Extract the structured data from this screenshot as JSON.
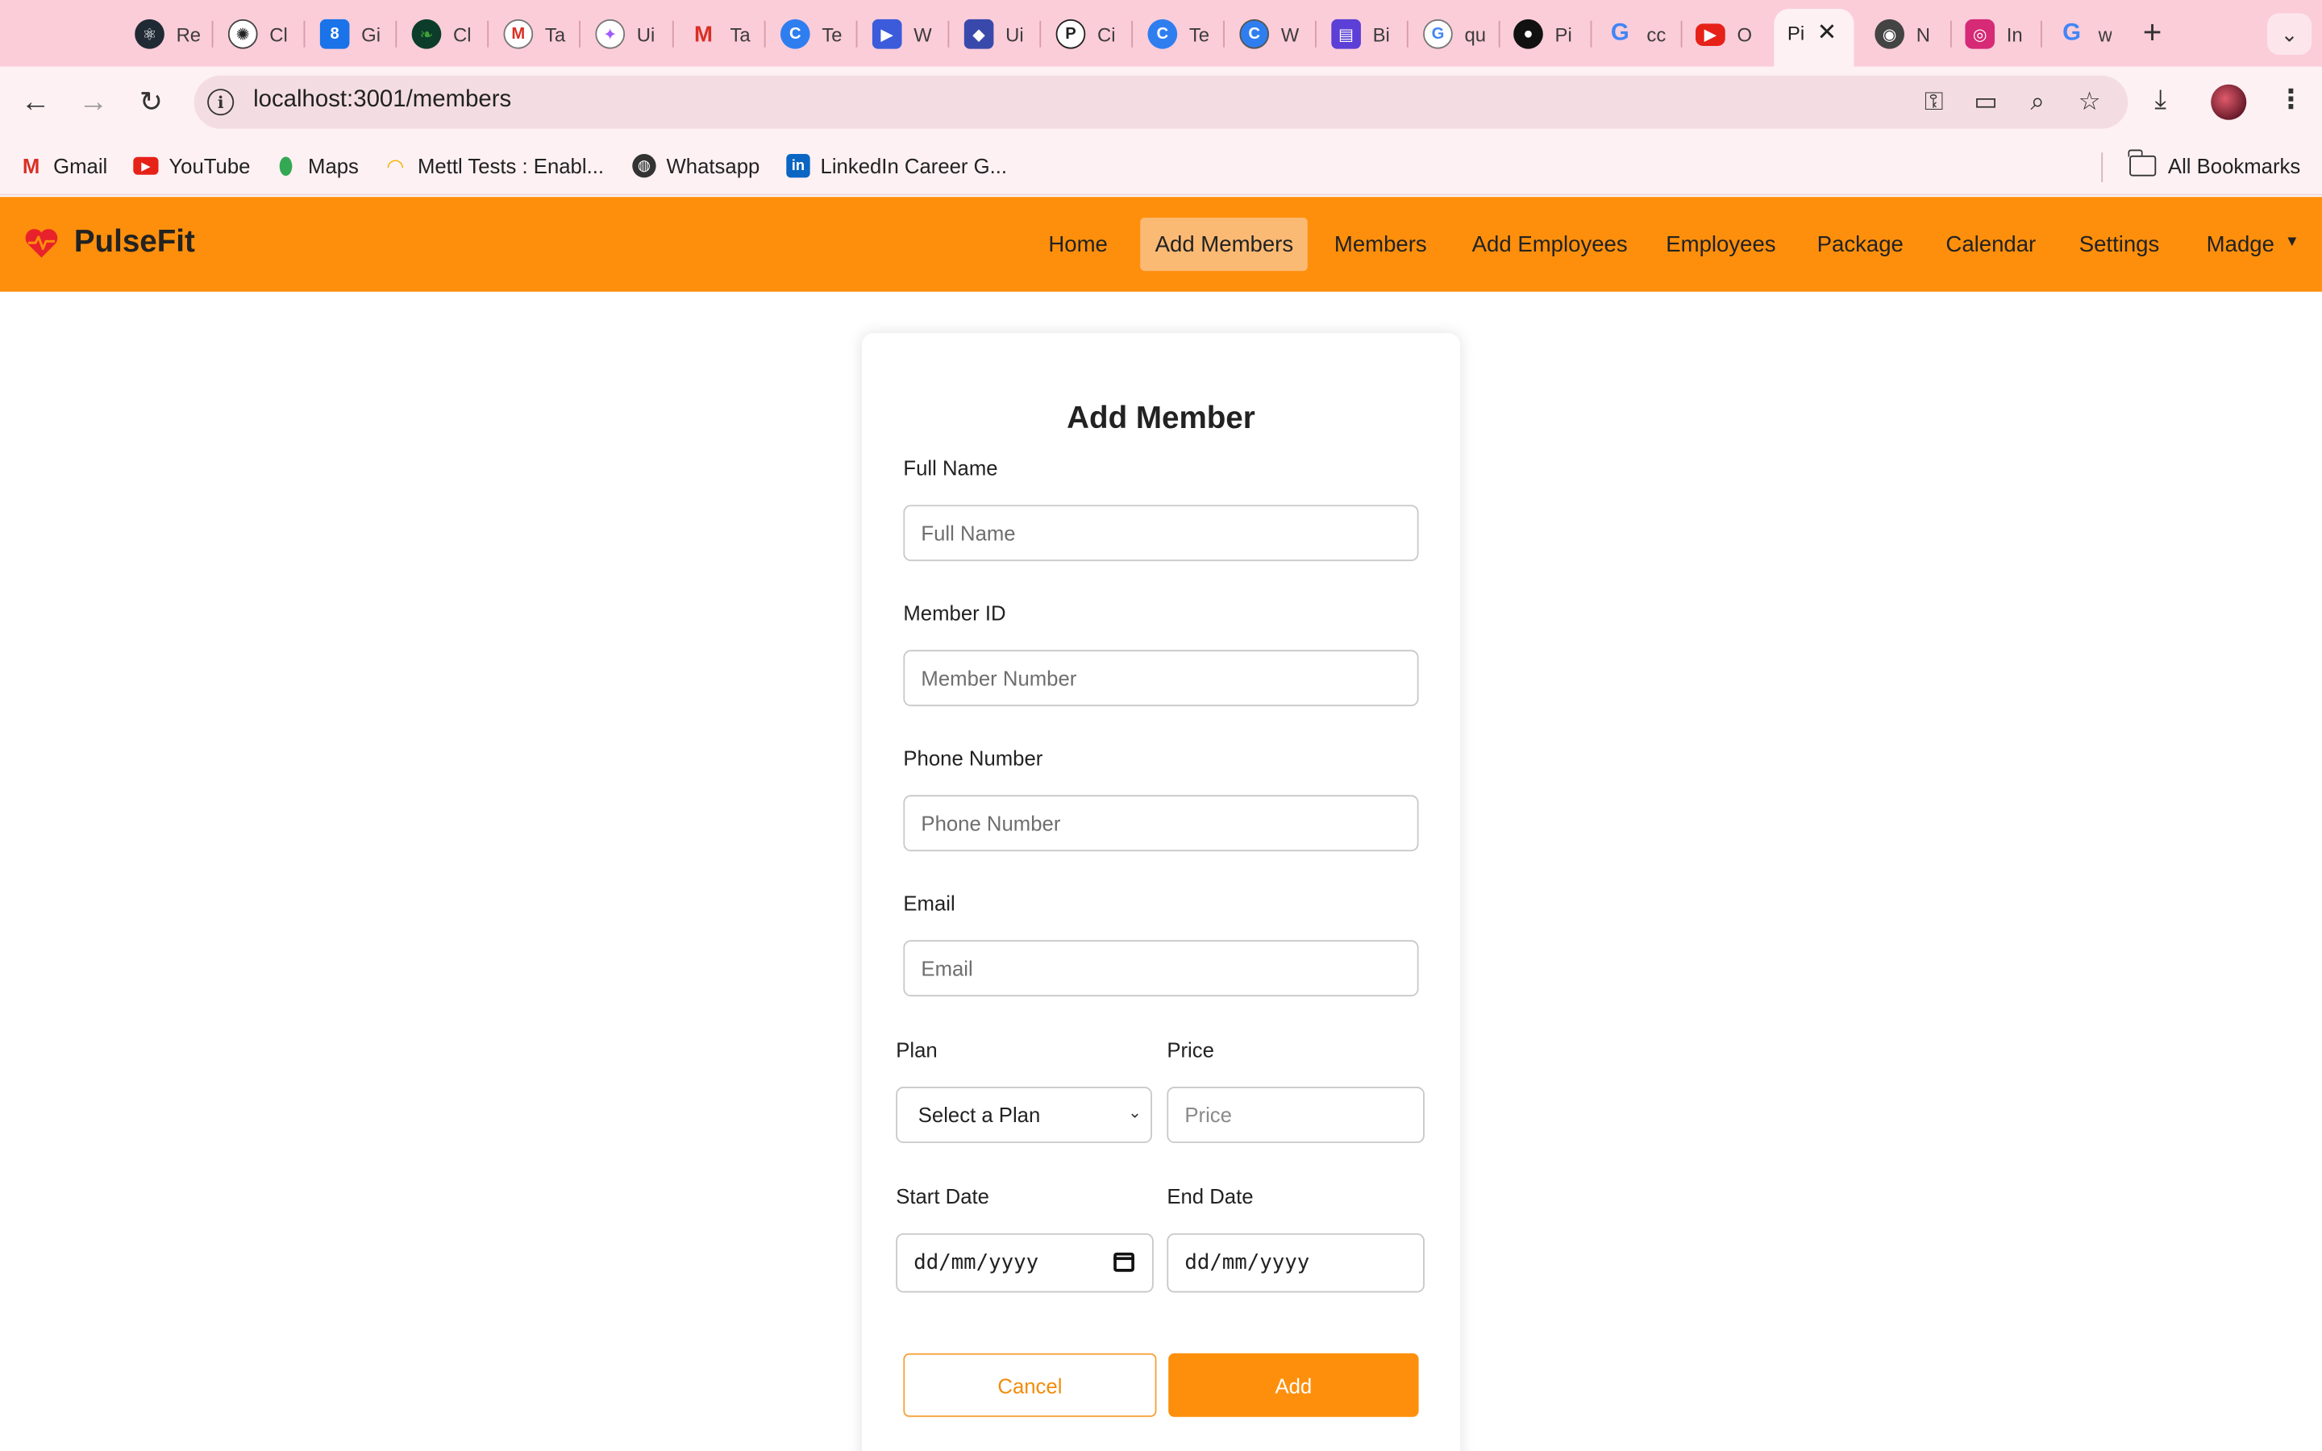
{
  "browser": {
    "tabs": [
      {
        "label": "Re",
        "icon": "react-icon",
        "color": "#1f2a35"
      },
      {
        "label": "Cl",
        "icon": "openai-icon",
        "color": "#444444"
      },
      {
        "label": "Gi",
        "icon": "calendar-8-icon",
        "color": "#1a73e8"
      },
      {
        "label": "Cl",
        "icon": "mongodb-leaf-icon",
        "color": "#0b3d2a"
      },
      {
        "label": "Ta",
        "icon": "gmail-icon",
        "color": "#d93025"
      },
      {
        "label": "Ui",
        "icon": "figma-icon",
        "color": "#a259ff"
      },
      {
        "label": "Ta",
        "icon": "gmail-icon",
        "color": "#d93025"
      },
      {
        "label": "Te",
        "icon": "canva-icon",
        "color": "#2f7ef0"
      },
      {
        "label": "W",
        "icon": "video-icon",
        "color": "#3b5bdb"
      },
      {
        "label": "Ui",
        "icon": "app-icon",
        "color": "#3949ab"
      },
      {
        "label": "Ci",
        "icon": "chatgpt-icon",
        "color": "#222222"
      },
      {
        "label": "Te",
        "icon": "canva-icon",
        "color": "#2f7ef0"
      },
      {
        "label": "W",
        "icon": "canva-icon",
        "color": "#2f7ef0"
      },
      {
        "label": "Bi",
        "icon": "printer-icon",
        "color": "#5b3fd6"
      },
      {
        "label": "qu",
        "icon": "google-icon",
        "color": "#4285f4"
      },
      {
        "label": "Pi",
        "icon": "github-icon",
        "color": "#111111"
      },
      {
        "label": "cc",
        "icon": "google-icon",
        "color": "#4285f4"
      },
      {
        "label": "O",
        "icon": "youtube-icon",
        "color": "#e62117"
      },
      {
        "label": "Pi",
        "icon": "pulsefit-icon",
        "color": "#fe8f0c",
        "active": true
      },
      {
        "label": "N",
        "icon": "chrome-icon",
        "color": "#444444"
      },
      {
        "label": "In",
        "icon": "instagram-icon",
        "color": "#d62976"
      },
      {
        "label": "w",
        "icon": "google-icon",
        "color": "#4285f4"
      }
    ],
    "url": "localhost:3001/members",
    "bookmarks": [
      {
        "label": "Gmail",
        "icon": "gmail-icon",
        "color": "#d93025"
      },
      {
        "label": "YouTube",
        "icon": "youtube-icon",
        "color": "#e62117"
      },
      {
        "label": "Maps",
        "icon": "maps-pin-icon",
        "color": "#34a853"
      },
      {
        "label": "Mettl Tests : Enabl...",
        "icon": "rainbow-icon",
        "color": "#f4b400"
      },
      {
        "label": "Whatsapp",
        "icon": "globe-icon",
        "color": "#333333"
      },
      {
        "label": "LinkedIn Career G...",
        "icon": "linkedin-icon",
        "color": "#0a66c2"
      }
    ],
    "all_bookmarks_label": "All Bookmarks"
  },
  "app": {
    "brand": "PulseFit",
    "brand_color": "#e8222a",
    "accent": "#fe8f0c",
    "nav": [
      {
        "label": "Home",
        "active": false
      },
      {
        "label": "Add Members",
        "active": true
      },
      {
        "label": "Members",
        "active": false
      },
      {
        "label": "Add Employees",
        "active": false
      },
      {
        "label": "Employees",
        "active": false
      },
      {
        "label": "Package",
        "active": false
      },
      {
        "label": "Calendar",
        "active": false
      },
      {
        "label": "Settings",
        "active": false
      },
      {
        "label": "Madge",
        "active": false,
        "dropdown": true
      }
    ]
  },
  "form": {
    "title": "Add Member",
    "full_name": {
      "label": "Full Name",
      "placeholder": "Full Name",
      "value": ""
    },
    "member_id": {
      "label": "Member ID",
      "placeholder": "Member Number",
      "value": ""
    },
    "phone": {
      "label": "Phone Number",
      "placeholder": "Phone Number",
      "value": ""
    },
    "email": {
      "label": "Email",
      "placeholder": "Email",
      "value": ""
    },
    "plan": {
      "label": "Plan",
      "selected": "Select a Plan"
    },
    "price": {
      "label": "Price",
      "placeholder": "Price",
      "value": ""
    },
    "start_date": {
      "label": "Start Date",
      "placeholder": "dd/mm/yyyy"
    },
    "end_date": {
      "label": "End Date",
      "placeholder": "dd/mm/yyyy"
    },
    "cancel_label": "Cancel",
    "add_label": "Add"
  }
}
